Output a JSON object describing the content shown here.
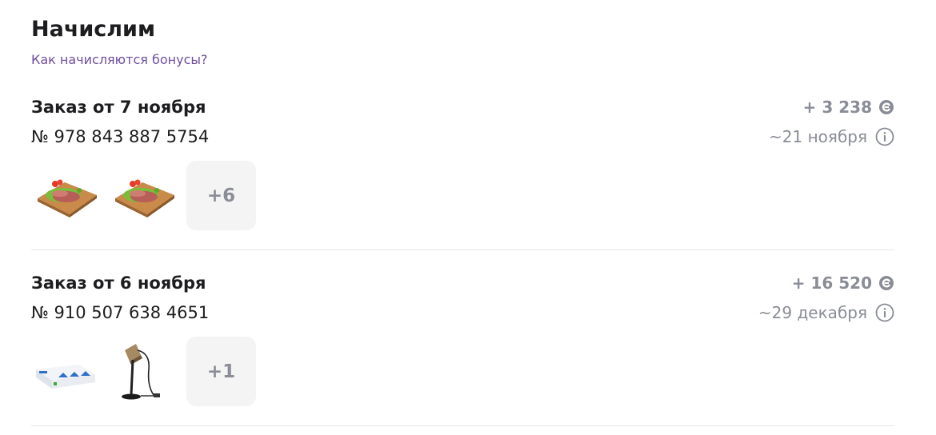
{
  "header": {
    "title": "Начислим",
    "help_link": "Как начисляются бонусы?"
  },
  "orders": [
    {
      "title": "Заказ от 7 ноября",
      "number": "№ 978 843 887 5754",
      "bonus": "+ 3 238",
      "date": "~21 ноября",
      "products": [
        "meat-on-board-image",
        "meat-on-board-image"
      ],
      "more_count": "+6"
    },
    {
      "title": "Заказ от 6 ноября",
      "number": "№ 910 507 638 4651",
      "bonus": "+ 16 520",
      "date": "~29 декабря",
      "products": [
        "led-bulbs-pack-image",
        "desk-lamp-image"
      ],
      "more_count": "+1"
    }
  ],
  "colors": {
    "accent_link": "#6f4ea1",
    "muted": "#8a8d96",
    "text": "#1d1d1f",
    "divider": "#e8e8ec"
  },
  "icons": {
    "bonus": "bonus-coin-icon",
    "info": "info-circle-icon"
  }
}
